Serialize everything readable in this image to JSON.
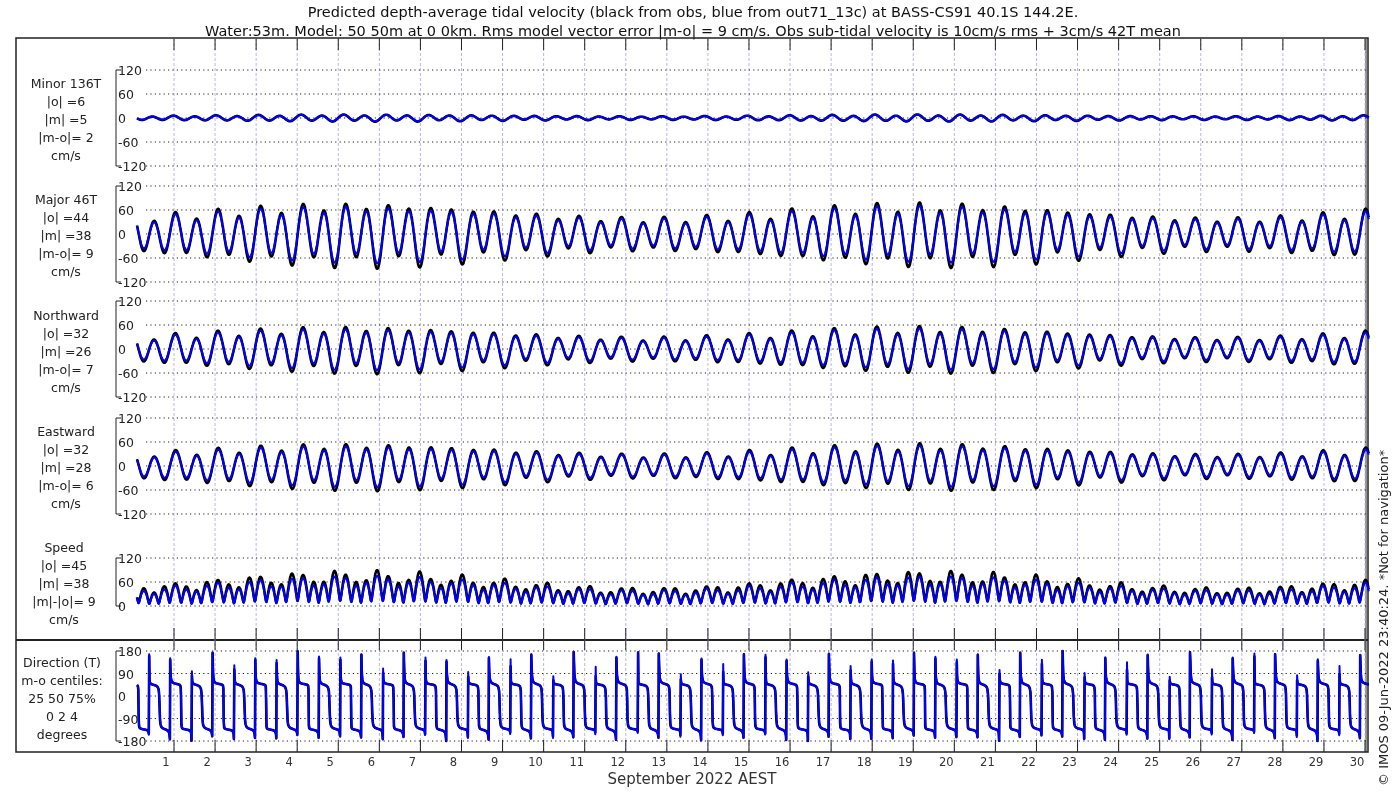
{
  "title": {
    "lines": [
      "Predicted depth-average tidal velocity (black from obs, blue from out71_13c) at BASS-CS91 40.1S 144.2E.",
      "Water:53m. Model: 50 50m at 0 0km. Rms model vector error |m-o| = 9 cm/s. Obs sub-tidal velocity is 10cm/s rms + 3cm/s 42T mean"
    ]
  },
  "panels": [
    {
      "kind": "minor",
      "label_lines": [
        "Minor 136T",
        "|o| =6",
        "|m| =5",
        "|m-o|= 2",
        "cm/s"
      ],
      "yticks": [
        "120",
        "60",
        "0",
        "-60",
        "-120"
      ]
    },
    {
      "kind": "major",
      "label_lines": [
        "Major 46T",
        "|o| =44",
        "|m| =38",
        "|m-o|= 9",
        "cm/s"
      ],
      "yticks": [
        "120",
        "60",
        "0",
        "-60",
        "-120"
      ]
    },
    {
      "kind": "northward",
      "label_lines": [
        "Northward",
        "|o| =32",
        "|m| =26",
        "|m-o|= 7",
        "cm/s"
      ],
      "yticks": [
        "120",
        "60",
        "0",
        "-60",
        "-120"
      ]
    },
    {
      "kind": "eastward",
      "label_lines": [
        "Eastward",
        "|o| =32",
        "|m| =28",
        "|m-o|= 6",
        "cm/s"
      ],
      "yticks": [
        "120",
        "60",
        "0",
        "-60",
        "-120"
      ]
    },
    {
      "kind": "speed",
      "label_lines": [
        "Speed",
        "|o| =45",
        "|m| =38",
        "|m|-|o|= 9",
        "cm/s"
      ],
      "yticks": [
        "120",
        "60",
        "0"
      ]
    },
    {
      "kind": "direction",
      "label_lines": [
        "Direction (T)",
        "m-o centiles:",
        "25  50  75%",
        "0  2  4",
        "degrees"
      ],
      "yticks": [
        "180",
        "90",
        "0",
        "-90",
        "-180"
      ]
    }
  ],
  "x_axis": {
    "day_labels": [
      "1",
      "2",
      "3",
      "4",
      "5",
      "6",
      "7",
      "8",
      "9",
      "10",
      "11",
      "12",
      "13",
      "14",
      "15",
      "16",
      "17",
      "18",
      "19",
      "20",
      "21",
      "22",
      "23",
      "24",
      "25",
      "26",
      "27",
      "28",
      "29",
      "30"
    ],
    "label": "September 2022 AEST"
  },
  "footnote": "© IMOS 09-Jun-2022 23:40:24. *Not for navigation*"
}
